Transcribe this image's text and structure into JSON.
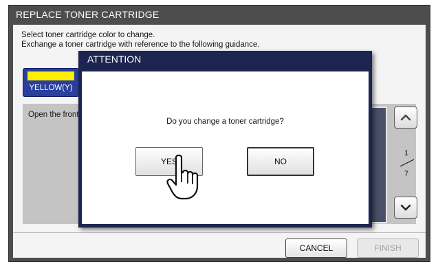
{
  "window": {
    "title": "REPLACE TONER CARTRIDGE"
  },
  "instructions": [
    "Select toner cartridge color to change.",
    "Exchange a toner cartridge with reference to the following guidance."
  ],
  "color_button": {
    "label": "YELLOW(Y)",
    "swatch_color": "#ffee00"
  },
  "guide": {
    "text": "Open the front cover."
  },
  "pagination": {
    "current": "1",
    "total": "7"
  },
  "footer": {
    "cancel_label": "CANCEL",
    "finish_label": "FINISH"
  },
  "dialog": {
    "title": "ATTENTION",
    "message": "Do you change a toner cartridge?",
    "yes_label": "YES",
    "no_label": "NO"
  },
  "icons": {
    "scroll_up": "chevron-up-icon",
    "scroll_down": "chevron-down-icon",
    "cursor": "hand-pointer-icon"
  },
  "colors": {
    "dialog_frame": "#1c2550",
    "color_button": "#2a3f9c"
  }
}
